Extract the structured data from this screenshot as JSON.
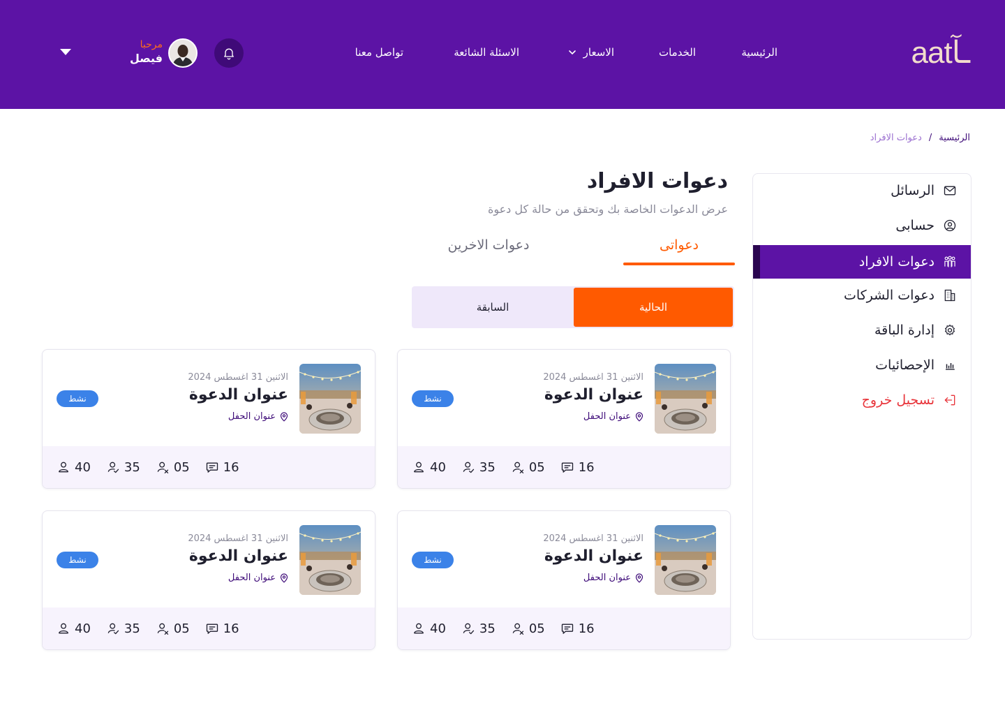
{
  "brand": {
    "logo_text": "aatـآ"
  },
  "nav": {
    "home": "الرئيسية",
    "services": "الخدمات",
    "pricing": "الاسعار",
    "faq": "الاسئلة الشائعة",
    "contact": "تواصل معنا"
  },
  "user": {
    "greeting": "مرحبا",
    "name": "فيصل"
  },
  "breadcrumb": {
    "home": "الرئيسية",
    "separator": "/",
    "current": "دعوات الافراد"
  },
  "sidebar": {
    "items": [
      {
        "label": "الرسائل",
        "icon": "mail-icon"
      },
      {
        "label": "حسابى",
        "icon": "user-circle-icon"
      },
      {
        "label": "دعوات الافراد",
        "icon": "people-icon",
        "active": true
      },
      {
        "label": "دعوات الشركات",
        "icon": "building-icon"
      },
      {
        "label": "إدارة الباقة",
        "icon": "gear-icon"
      },
      {
        "label": "الإحصائيات",
        "icon": "chart-icon"
      },
      {
        "label": "تسجيل خروج",
        "icon": "logout-icon"
      }
    ]
  },
  "page": {
    "title": "دعوات الافراد",
    "subtitle": "عرض الدعوات الخاصة بك وتحقق من حالة كل دعوة"
  },
  "tabs": {
    "mine": "دعواتى",
    "others": "دعوات الاخرين"
  },
  "segment": {
    "current": "الحالية",
    "previous": "السابقة"
  },
  "cards": [
    {
      "date": "الاثنين 31 اغسطس 2024",
      "title": "عنوان الدعوة",
      "address": "عنوان الحفل",
      "status": "نشط",
      "stats": {
        "guests": "40",
        "confirmed": "35",
        "declined": "05",
        "messages": "16"
      }
    },
    {
      "date": "الاثنين 31 اغسطس 2024",
      "title": "عنوان الدعوة",
      "address": "عنوان الحفل",
      "status": "نشط",
      "stats": {
        "guests": "40",
        "confirmed": "35",
        "declined": "05",
        "messages": "16"
      }
    },
    {
      "date": "الاثنين 31 اغسطس 2024",
      "title": "عنوان الدعوة",
      "address": "عنوان الحفل",
      "status": "نشط",
      "stats": {
        "guests": "40",
        "confirmed": "35",
        "declined": "05",
        "messages": "16"
      }
    },
    {
      "date": "الاثنين 31 اغسطس 2024",
      "title": "عنوان الدعوة",
      "address": "عنوان الحفل",
      "status": "نشط",
      "stats": {
        "guests": "40",
        "confirmed": "35",
        "declined": "05",
        "messages": "16"
      }
    }
  ],
  "colors": {
    "header_bg": "#5c13a5",
    "accent_orange": "#ff5a00",
    "active_sidebar": "#5c13a5",
    "status_badge": "#3b82e8",
    "logout_red": "#e8343a"
  }
}
